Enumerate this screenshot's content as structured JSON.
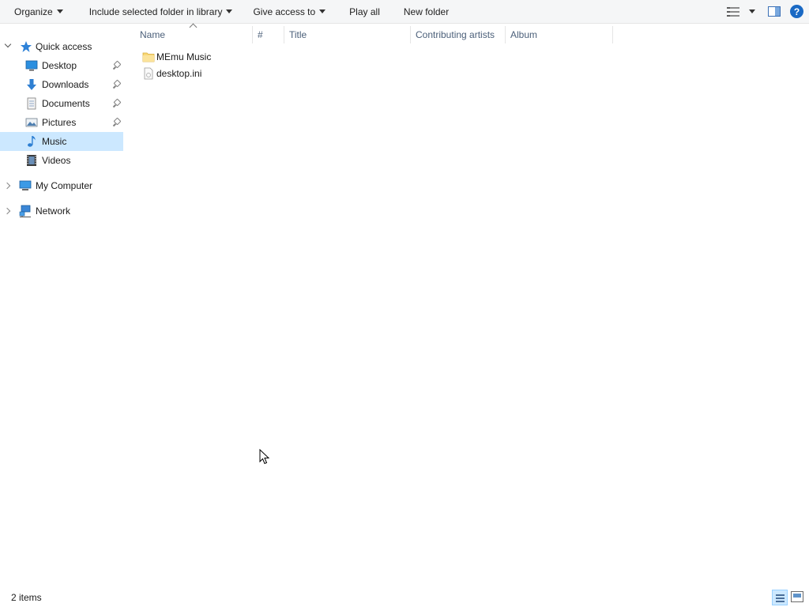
{
  "toolbar": {
    "organize": "Organize",
    "include_library": "Include selected folder in library",
    "give_access": "Give access to",
    "play_all": "Play all",
    "new_folder": "New folder",
    "help": "?"
  },
  "nav": {
    "quick_access": "Quick access",
    "items": [
      {
        "label": "Desktop",
        "icon": "desktop-icon",
        "pinned": true
      },
      {
        "label": "Downloads",
        "icon": "downloads-icon",
        "pinned": true
      },
      {
        "label": "Documents",
        "icon": "documents-icon",
        "pinned": true
      },
      {
        "label": "Pictures",
        "icon": "pictures-icon",
        "pinned": true
      },
      {
        "label": "Music",
        "icon": "music-icon",
        "pinned": false,
        "selected": true
      },
      {
        "label": "Videos",
        "icon": "videos-icon",
        "pinned": false
      }
    ],
    "my_computer": "My Computer",
    "network": "Network"
  },
  "columns": [
    "Name",
    "#",
    "Title",
    "Contributing artists",
    "Album"
  ],
  "files": [
    {
      "name": "MEmu Music",
      "icon": "folder-icon"
    },
    {
      "name": "desktop.ini",
      "icon": "settings-file-icon"
    }
  ],
  "status": {
    "item_count": "2 items"
  },
  "colors": {
    "selection": "#cce8ff",
    "header_text": "#4c607a",
    "accent": "#1a69c4"
  }
}
